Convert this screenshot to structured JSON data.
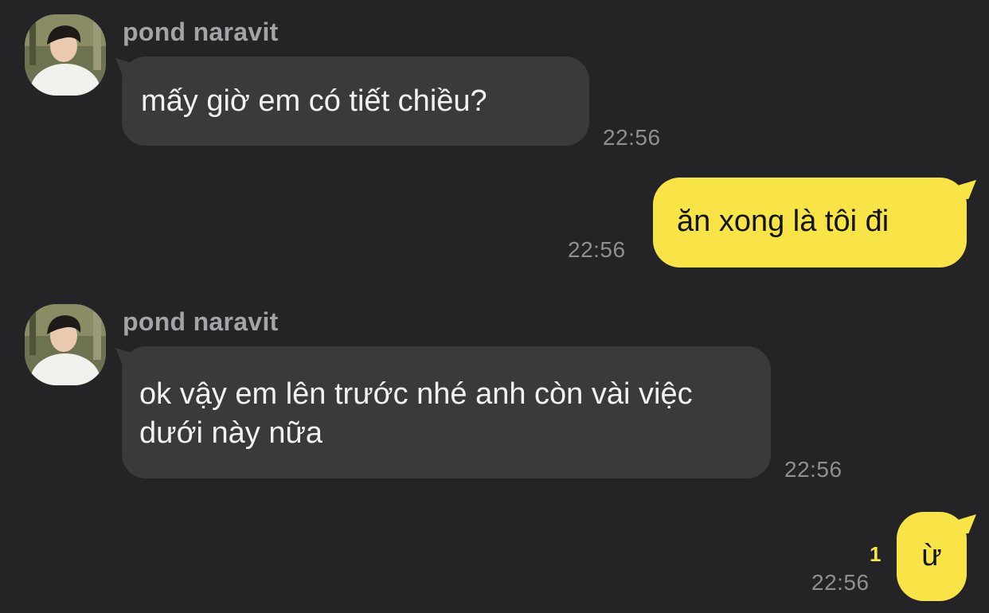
{
  "messages": [
    {
      "direction": "incoming",
      "sender": "pond naravit",
      "text": "mấy giờ em có tiết chiều?",
      "time": "22:56"
    },
    {
      "direction": "outgoing",
      "text": "ăn xong là tôi đi",
      "time": "22:56"
    },
    {
      "direction": "incoming",
      "sender": "pond naravit",
      "text": "ok vậy em lên trước nhé anh còn vài việc dưới này nữa",
      "time": "22:56"
    },
    {
      "direction": "outgoing",
      "text": "ừ",
      "time": "22:56",
      "unread_count": "1"
    }
  ],
  "colors": {
    "background": "#242426",
    "incoming_bubble": "#3a3a3d",
    "outgoing_bubble": "#f8e447",
    "unread_badge": "#f8e447",
    "timestamp": "#8e8e93"
  }
}
